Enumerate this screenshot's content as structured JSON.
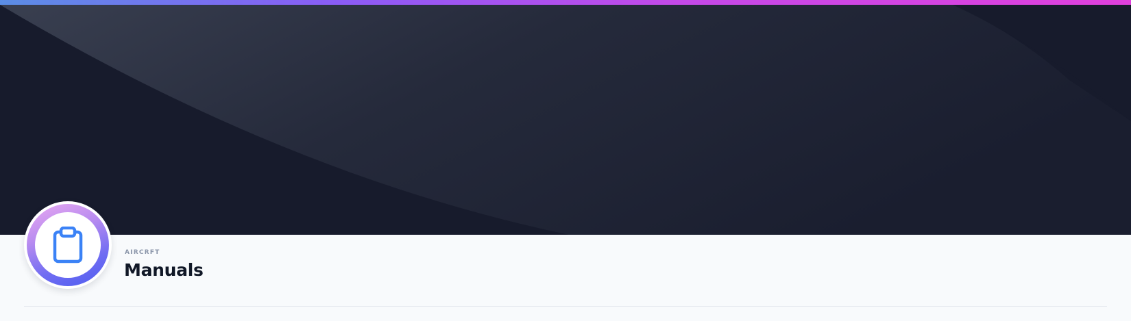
{
  "header": {
    "eyebrow": "AIRCRFT",
    "title": "Manuals",
    "icon": "clipboard-icon"
  },
  "colors": {
    "accent_start": "#5b8ee6",
    "accent_end": "#e040dc",
    "hero_background": "#171b2c",
    "title_text": "#111827",
    "eyebrow_text": "#8b96aa",
    "icon_stroke": "#3b82f6"
  }
}
